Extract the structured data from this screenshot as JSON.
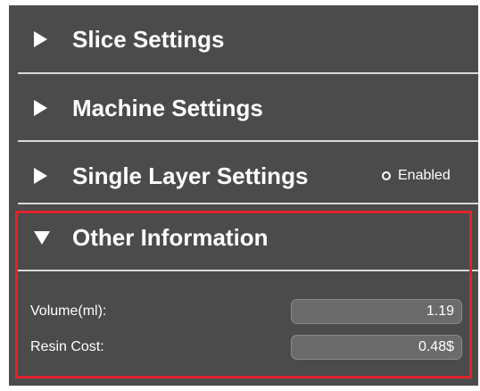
{
  "sections": [
    {
      "title": "Slice Settings",
      "state": "collapsed"
    },
    {
      "title": "Machine Settings",
      "state": "collapsed"
    },
    {
      "title": "Single Layer Settings",
      "state": "collapsed",
      "toggle_label": "Enabled"
    },
    {
      "title": "Other Information",
      "state": "expanded"
    }
  ],
  "other_information": {
    "volume_label": "Volume(ml):",
    "volume_value": "1.19",
    "resin_cost_label": "Resin Cost:",
    "resin_cost_value": "0.48$"
  },
  "colors": {
    "panel_background": "#4b4b4b",
    "field_background": "#6b6b6b",
    "highlight_border": "#e0242b",
    "text": "#ffffff"
  },
  "icons": {
    "collapsed": "triangle-right-icon",
    "expanded": "triangle-down-icon",
    "toggle": "radio-circle-icon"
  }
}
